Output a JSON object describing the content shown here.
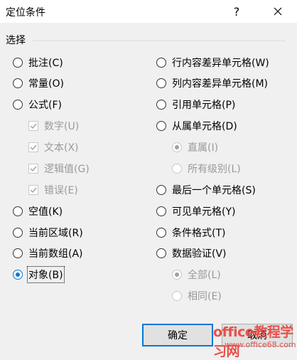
{
  "window": {
    "title": "定位条件",
    "help": "?",
    "close": "✕"
  },
  "section_label": "选择",
  "left_options": [
    {
      "label": "批注(C)",
      "state": "unchecked"
    },
    {
      "label": "常量(O)",
      "state": "unchecked"
    },
    {
      "label": "公式(F)",
      "state": "unchecked"
    },
    {
      "label": "数字(U)",
      "state": "checked-disabled"
    },
    {
      "label": "文本(X)",
      "state": "checked-disabled"
    },
    {
      "label": "逻辑值(G)",
      "state": "checked-disabled"
    },
    {
      "label": "错误(E)",
      "state": "checked-disabled"
    },
    {
      "label": "空值(K)",
      "state": "unchecked"
    },
    {
      "label": "当前区域(R)",
      "state": "unchecked"
    },
    {
      "label": "当前数组(A)",
      "state": "unchecked"
    },
    {
      "label": "对象(B)",
      "state": "checked"
    }
  ],
  "right_options": [
    {
      "label": "行内容差异单元格(W)",
      "state": "unchecked"
    },
    {
      "label": "列内容差异单元格(M)",
      "state": "unchecked"
    },
    {
      "label": "引用单元格(P)",
      "state": "unchecked"
    },
    {
      "label": "从属单元格(D)",
      "state": "unchecked"
    },
    {
      "label": "直属(I)",
      "state": "checked-disabled"
    },
    {
      "label": "所有级别(L)",
      "state": "disabled"
    },
    {
      "label": "最后一个单元格(S)",
      "state": "unchecked"
    },
    {
      "label": "可见单元格(Y)",
      "state": "unchecked"
    },
    {
      "label": "条件格式(T)",
      "state": "unchecked"
    },
    {
      "label": "数据验证(V)",
      "state": "unchecked"
    },
    {
      "label": "全部(L)",
      "state": "checked-disabled"
    },
    {
      "label": "相同(E)",
      "state": "disabled"
    }
  ],
  "buttons": {
    "ok": "确定",
    "cancel": "取消"
  },
  "watermark": {
    "title": "office教程学习网",
    "url": "www.office68.com"
  },
  "colors": {
    "accent": "#0078d7",
    "watermark": "#e8504a"
  }
}
